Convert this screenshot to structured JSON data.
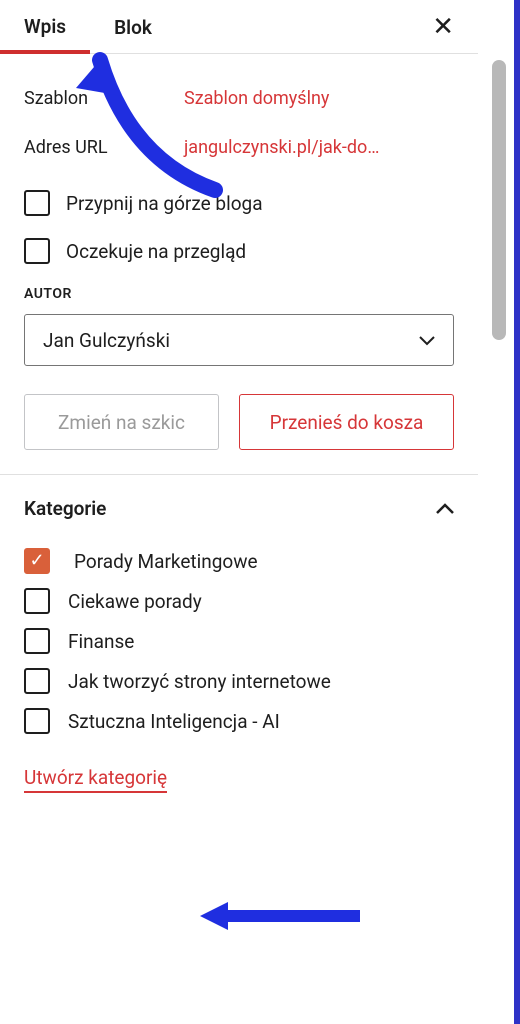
{
  "tabs": {
    "post": "Wpis",
    "block": "Blok",
    "closeGlyph": "✕"
  },
  "template": {
    "label": "Szablon",
    "value": "Szablon domyślny"
  },
  "url": {
    "label": "Adres URL",
    "value": "jangulczynski.pl/jak-do…"
  },
  "sticky": {
    "label": "Przypnij na górze bloga"
  },
  "pending": {
    "label": "Oczekuje na przegląd"
  },
  "author": {
    "heading": "AUTOR",
    "value": "Jan Gulczyński",
    "chevron": "⌄"
  },
  "buttons": {
    "draft": "Zmień na szkic",
    "trash": "Przenieś do kosza"
  },
  "categories": {
    "heading": "Kategorie",
    "caret": "⌃",
    "items": [
      {
        "label": "Porady Marketingowe",
        "checked": true
      },
      {
        "label": "Ciekawe porady",
        "checked": false
      },
      {
        "label": "Finanse",
        "checked": false
      },
      {
        "label": "Jak tworzyć strony internetowe",
        "checked": false
      },
      {
        "label": "Sztuczna Inteligencja - AI",
        "checked": false
      }
    ],
    "create": "Utwórz kategorię"
  }
}
